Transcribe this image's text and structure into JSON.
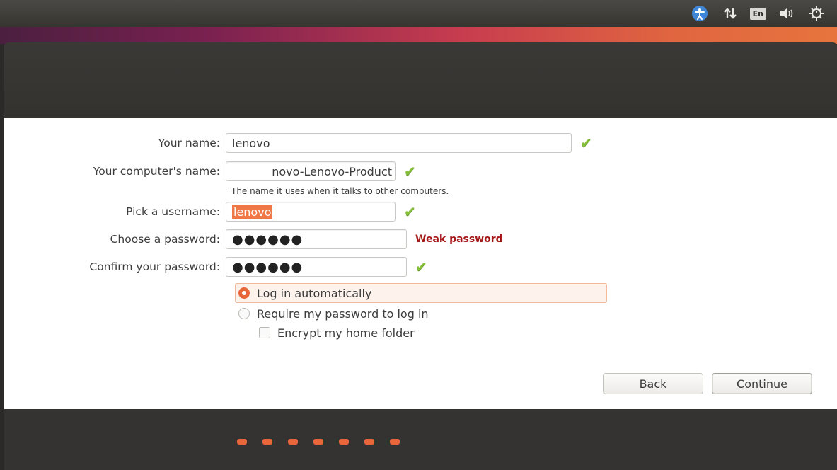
{
  "tray": {
    "accessibility_icon": "accessibility-icon",
    "network_icon": "network-updown-icon",
    "language": "En",
    "volume_icon": "volume-icon",
    "power_icon": "gear-power-icon"
  },
  "form": {
    "your_name": {
      "label": "Your name:",
      "value": "lenovo"
    },
    "computer_name": {
      "label": "Your computer's name:",
      "value": "novo-Lenovo-Product",
      "hint": "The name it uses when it talks to other computers."
    },
    "username": {
      "label": "Pick a username:",
      "value": "lenovo"
    },
    "password": {
      "label": "Choose a password:",
      "value": "●●●●●●",
      "strength": "Weak password"
    },
    "confirm": {
      "label": "Confirm your password:",
      "value": "●●●●●●"
    }
  },
  "options": {
    "log_in_auto": "Log in automatically",
    "require_password": "Require my password to log in",
    "encrypt_home": "Encrypt my home folder",
    "selected": "log_in_auto",
    "encrypt_checked": false
  },
  "buttons": {
    "back": "Back",
    "continue": "Continue"
  },
  "progress": {
    "steps": 7,
    "color": "#e9663b"
  },
  "colors": {
    "accent": "#e9663b",
    "ok": "#87c039",
    "weak": "#a61717"
  }
}
